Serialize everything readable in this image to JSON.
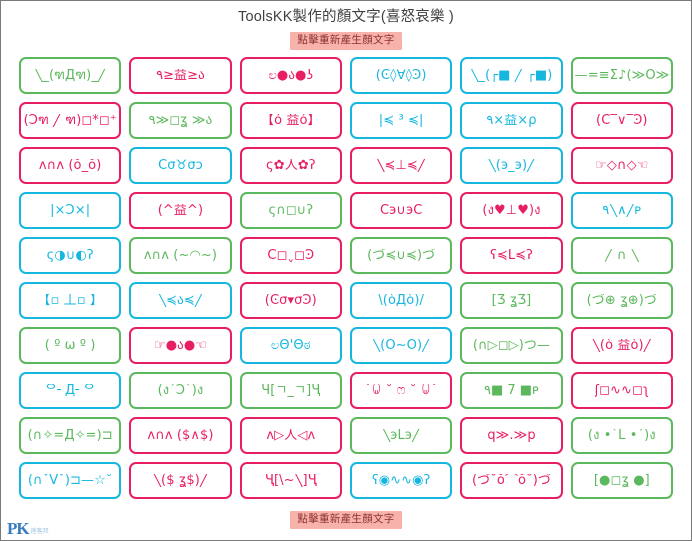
{
  "header": {
    "title": "ToolsKK製作的顏文字(喜怒哀樂 )",
    "regenerate_label": "點擊重新產生顏文字"
  },
  "footer": {
    "regenerate_label": "點擊重新產生顏文字",
    "watermark": "PK",
    "watermark_sub": "痞客邦"
  },
  "colors": {
    "green": "#5cb85c",
    "pink": "#e81e63",
    "cyan": "#16b7df",
    "button_background": "#f7b3ab",
    "button_text": "#8d2f2f",
    "title_text": "#404040",
    "page_border": "#7a7a7a"
  },
  "grid": {
    "columns": 6,
    "rows": 10,
    "cells": [
      {
        "text": "╲_(ฑДฑ)_╱",
        "color": "green"
      },
      {
        "text": "٩≥益≥ა",
        "color": "pink"
      },
      {
        "text": "ಲ●ა●ʖ",
        "color": "pink"
      },
      {
        "text": "(Ͼ◊∀◊Ͽ)",
        "color": "cyan"
      },
      {
        "text": "╲_(┌■ ╱ ┌■)",
        "color": "cyan"
      },
      {
        "text": "—=≡Σ♪(≫Ô≫",
        "color": "green"
      },
      {
        "text": "(Ɔฑ ╱ ฑ)◻*◻⁺",
        "color": "pink"
      },
      {
        "text": "٩≫◻ʓ ≫ა",
        "color": "green"
      },
      {
        "text": "【ó 益ó】",
        "color": "pink"
      },
      {
        "text": "|≼ ³ ≼|",
        "color": "cyan"
      },
      {
        "text": "۹×益×ρ",
        "color": "cyan"
      },
      {
        "text": "(Ϲ‾∨‾Ͽ)",
        "color": "pink"
      },
      {
        "text": "ʌ∩ʌ (ŏ_ŏ)",
        "color": "pink"
      },
      {
        "text": "Ϲσ♉σͻ",
        "color": "cyan"
      },
      {
        "text": "ς✿人✿ʔ",
        "color": "pink"
      },
      {
        "text": "╲≼⊥≼╱",
        "color": "pink"
      },
      {
        "text": "╲(э_э)╱",
        "color": "cyan"
      },
      {
        "text": "☞◇∩◇☜",
        "color": "pink"
      },
      {
        "text": "|×Ɔ×|",
        "color": "cyan"
      },
      {
        "text": "(^益^)",
        "color": "pink"
      },
      {
        "text": "ς∩◻∪ʔ",
        "color": "green"
      },
      {
        "text": "Ϲэ∪эϹ",
        "color": "pink"
      },
      {
        "text": "(ง♥⊥♥)ง",
        "color": "pink"
      },
      {
        "text": "٩╲∧╱ᴘ",
        "color": "cyan"
      },
      {
        "text": "ς◑∪◐ʔ",
        "color": "cyan"
      },
      {
        "text": "ʌ∩ʌ (~◠~)",
        "color": "green"
      },
      {
        "text": "Ϲ◻ˬ◻Ͽ",
        "color": "pink"
      },
      {
        "text": "(づ≼∪≼)づ",
        "color": "green"
      },
      {
        "text": "ʕ≼Ĺ≼ʔ",
        "color": "pink"
      },
      {
        "text": "╱ ∩ ╲",
        "color": "green"
      },
      {
        "text": "【▫ 丄▫ 】",
        "color": "cyan"
      },
      {
        "text": "╲≼ა≼╱",
        "color": "cyan"
      },
      {
        "text": "(Ͼσ▾σϿ)",
        "color": "pink"
      },
      {
        "text": "\\(òДò)/",
        "color": "cyan"
      },
      {
        "text": "[Ʒ ʓƷ]",
        "color": "green"
      },
      {
        "text": "(づ⊕ ʓ⊕)づ",
        "color": "green"
      },
      {
        "text": "( º ω º )",
        "color": "green"
      },
      {
        "text": "☞●ა●☜",
        "color": "pink"
      },
      {
        "text": "ಲΘ'Θಠ",
        "color": "cyan"
      },
      {
        "text": "╲(Ō∼Ō)╱",
        "color": "cyan"
      },
      {
        "text": "(∩▷◻▷)つ—",
        "color": "green"
      },
      {
        "text": "╲(ò 益ò)╱",
        "color": "pink"
      },
      {
        "text": "ᄋ╴Д╴ᄋ",
        "color": "cyan"
      },
      {
        "text": "(ง´Ɔ`)ง",
        "color": "green"
      },
      {
        "text": "Ч[ㄱ_ㄱ]Ҷ",
        "color": "green"
      },
      {
        "text": "˙ꐑ ˚ ෆ ˚ ꐑ˙",
        "color": "pink"
      },
      {
        "text": "٩■ 7 ■ᴘ",
        "color": "green"
      },
      {
        "text": "ʃ◻∿∿◻ʅ",
        "color": "pink"
      },
      {
        "text": "(∩✧=Д✧=)⊐",
        "color": "green"
      },
      {
        "text": "ʌ∩ʌ ($∧$)",
        "color": "pink"
      },
      {
        "text": "ʌ▷人◁ʌ",
        "color": "pink"
      },
      {
        "text": "╲эĹэ╱",
        "color": "green"
      },
      {
        "text": "q≫.≫p",
        "color": "pink"
      },
      {
        "text": "(ง •`Ĺ •´)ง",
        "color": "green"
      },
      {
        "text": "(∩ˇV̌ˇ)⊐—☆˚",
        "color": "cyan"
      },
      {
        "text": "╲($ ʓ$)╱",
        "color": "pink"
      },
      {
        "text": "Ҷ[\\~╲]Ҷ",
        "color": "pink"
      },
      {
        "text": "ʕ◉∿∿◉ʔ",
        "color": "cyan"
      },
      {
        "text": "(づ˘ŏ⌒ŏ˘)づ",
        "color": "pink"
      },
      {
        "text": "[●◻ʓ ●]",
        "color": "green"
      }
    ]
  }
}
